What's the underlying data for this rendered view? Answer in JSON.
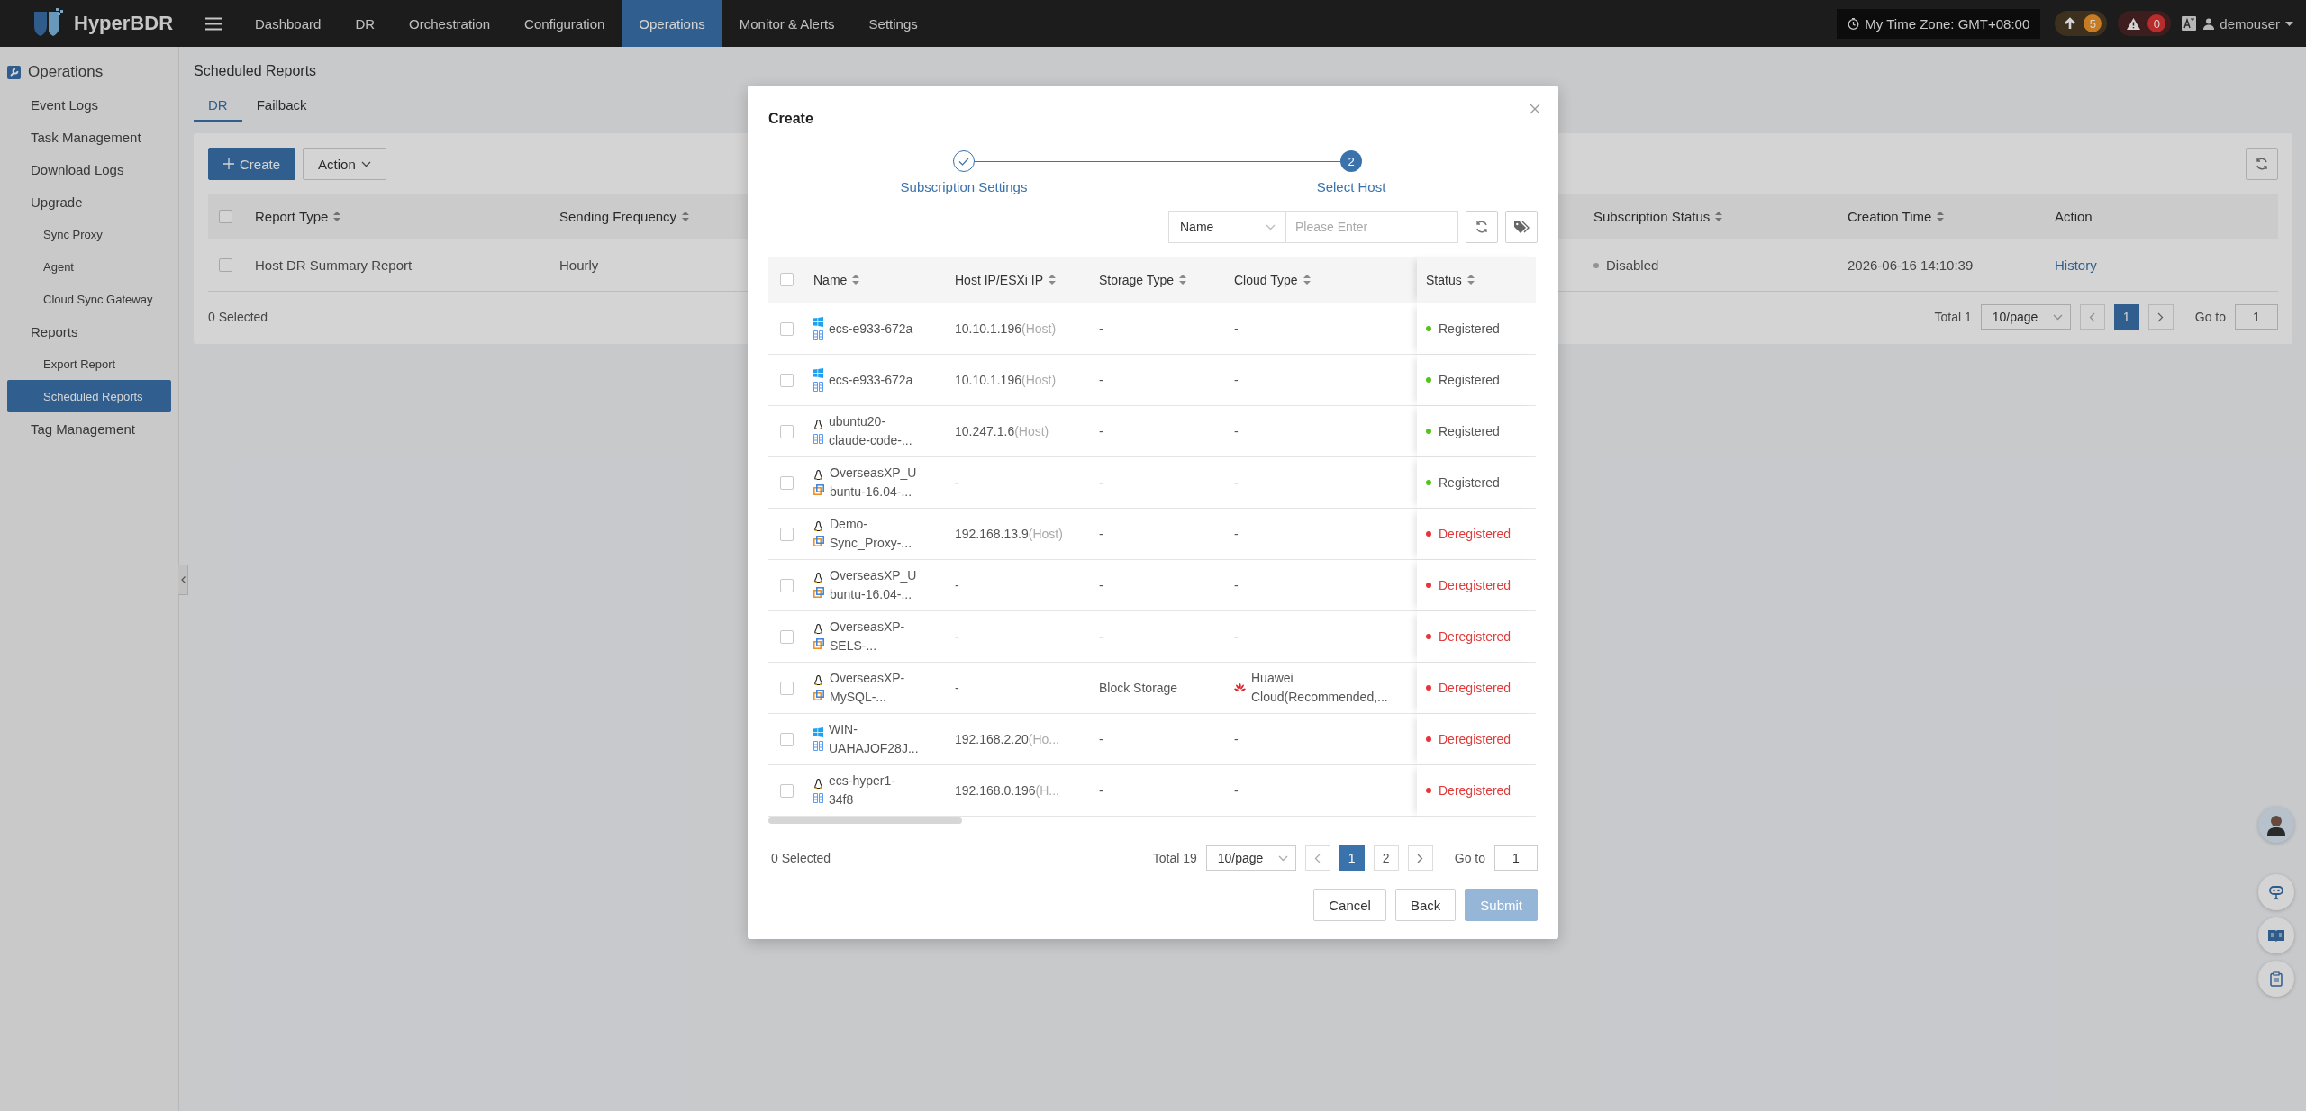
{
  "topbar": {
    "brand": "HyperBDR",
    "nav": [
      {
        "label": "Dashboard",
        "selected": false
      },
      {
        "label": "DR",
        "selected": false
      },
      {
        "label": "Orchestration",
        "selected": false
      },
      {
        "label": "Configuration",
        "selected": false
      },
      {
        "label": "Operations",
        "selected": true
      },
      {
        "label": "Monitor & Alerts",
        "selected": false
      },
      {
        "label": "Settings",
        "selected": false
      }
    ],
    "timezone": "My Time Zone: GMT+08:00",
    "upgrades": "5",
    "alerts": "0",
    "user": "demouser"
  },
  "sidebar": {
    "title": "Operations",
    "items": [
      {
        "label": "Event Logs",
        "selected": false
      },
      {
        "label": "Task Management",
        "selected": false
      },
      {
        "label": "Download Logs",
        "selected": false
      },
      {
        "label": "Upgrade",
        "selected": false,
        "children": [
          {
            "label": "Sync Proxy",
            "selected": false
          },
          {
            "label": "Agent",
            "selected": false
          },
          {
            "label": "Cloud Sync Gateway",
            "selected": false
          }
        ]
      },
      {
        "label": "Reports",
        "selected": false,
        "children": [
          {
            "label": "Export Report",
            "selected": false
          },
          {
            "label": "Scheduled Reports",
            "selected": true
          }
        ]
      },
      {
        "label": "Tag Management",
        "selected": false
      }
    ]
  },
  "page": {
    "title": "Scheduled Reports",
    "tabs": [
      {
        "label": "DR",
        "selected": true
      },
      {
        "label": "Failback",
        "selected": false
      }
    ],
    "create": "Create",
    "action": "Action",
    "table": {
      "all_checked": false,
      "columns": [
        {
          "label": "Report Type",
          "sortable": true
        },
        {
          "label": "Sending Frequency",
          "sortable": true
        },
        {
          "label": "Subscription Status",
          "sortable": true
        },
        {
          "label": "Creation Time",
          "sortable": true
        },
        {
          "label": "Action",
          "sortable": false
        }
      ],
      "rows": [
        {
          "checked": false,
          "report_type": "Host DR Summary Report",
          "frequency": "Hourly",
          "status": "Disabled",
          "color": "#b0b0b0",
          "error": false,
          "created": "2026-06-16 14:10:39",
          "action": "History"
        }
      ]
    },
    "footer": {
      "selected": "0 Selected",
      "total": "Total 1",
      "page_size": "10/page",
      "pages": [
        {
          "label": "1",
          "selected": true
        }
      ],
      "goto": "Go to",
      "goto_value": "1"
    }
  },
  "dialog": {
    "title": "Create",
    "steps": [
      {
        "label": "Subscription Settings",
        "done": true
      },
      {
        "label": "Select Host",
        "done": false,
        "number": "2"
      }
    ],
    "filter": {
      "field": "Name",
      "placeholder": "Please Enter"
    },
    "table": {
      "all_checked": false,
      "columns": [
        {
          "label": "Name",
          "sortable": true
        },
        {
          "label": "Host IP/ESXi IP",
          "sortable": true
        },
        {
          "label": "Storage Type",
          "sortable": true
        },
        {
          "label": "Cloud Type",
          "sortable": true
        },
        {
          "label": "Status",
          "sortable": true
        }
      ],
      "rows": [
        {
          "checked": false,
          "icons": [
            {
              "kind": "windows"
            },
            {
              "kind": "grid"
            }
          ],
          "name": "ecs-e933-672a",
          "ip": "10.10.1.196",
          "ip_note": "(Host)",
          "storage": "-",
          "cloud": "-",
          "status": "Registered",
          "color": "#52c41a",
          "error": false
        },
        {
          "checked": false,
          "icons": [
            {
              "kind": "windows"
            },
            {
              "kind": "grid"
            }
          ],
          "name": "ecs-e933-672a",
          "ip": "10.10.1.196",
          "ip_note": "(Host)",
          "storage": "-",
          "cloud": "-",
          "status": "Registered",
          "color": "#52c41a",
          "error": false
        },
        {
          "checked": false,
          "icons": [
            {
              "kind": "linux"
            },
            {
              "kind": "grid"
            }
          ],
          "name": "ubuntu20-claude-code-...",
          "ip": "10.247.1.6",
          "ip_note": "(Host)",
          "storage": "-",
          "cloud": "-",
          "status": "Registered",
          "color": "#52c41a",
          "error": false
        },
        {
          "checked": false,
          "icons": [
            {
              "kind": "linux"
            },
            {
              "kind": "stack"
            }
          ],
          "name": "OverseasXP_Ubuntu-16.04-...",
          "ip": "-",
          "storage": "-",
          "cloud": "-",
          "status": "Registered",
          "color": "#52c41a",
          "error": false
        },
        {
          "checked": false,
          "icons": [
            {
              "kind": "linux"
            },
            {
              "kind": "stack"
            }
          ],
          "name": "Demo-Sync_Proxy-...",
          "ip": "192.168.13.9",
          "ip_note": "(Host)",
          "storage": "-",
          "cloud": "-",
          "status": "Deregistered",
          "color": "#e8333a",
          "error": true
        },
        {
          "checked": false,
          "icons": [
            {
              "kind": "linux"
            },
            {
              "kind": "stack"
            }
          ],
          "name": "OverseasXP_Ubuntu-16.04-...",
          "ip": "-",
          "storage": "-",
          "cloud": "-",
          "status": "Deregistered",
          "color": "#e8333a",
          "error": true
        },
        {
          "checked": false,
          "icons": [
            {
              "kind": "linux"
            },
            {
              "kind": "stack"
            }
          ],
          "name": "OverseasXP-SELS-...",
          "ip": "-",
          "storage": "-",
          "cloud": "-",
          "status": "Deregistered",
          "color": "#e8333a",
          "error": true
        },
        {
          "checked": false,
          "icons": [
            {
              "kind": "linux"
            },
            {
              "kind": "stack"
            }
          ],
          "name": "OverseasXP-MySQL-...",
          "ip": "-",
          "storage": "Block Storage",
          "cloud": "Huawei Cloud(Recommended,...",
          "cloud_icons": [
            {
              "kind": "flower"
            }
          ],
          "status": "Deregistered",
          "color": "#e8333a",
          "error": true
        },
        {
          "checked": false,
          "icons": [
            {
              "kind": "windows"
            },
            {
              "kind": "grid"
            }
          ],
          "name": "WIN-UAHAJOF28J...",
          "ip": "192.168.2.20",
          "ip_note": "(Ho...",
          "storage": "-",
          "cloud": "-",
          "status": "Deregistered",
          "color": "#e8333a",
          "error": true
        },
        {
          "checked": false,
          "icons": [
            {
              "kind": "linux"
            },
            {
              "kind": "grid"
            }
          ],
          "name": "ecs-hyper1-34f8",
          "ip": "192.168.0.196",
          "ip_note": "(H...",
          "storage": "-",
          "cloud": "-",
          "status": "Deregistered",
          "color": "#e8333a",
          "error": true
        }
      ]
    },
    "footer": {
      "selected": "0 Selected",
      "total": "Total 19",
      "page_size": "10/page",
      "pages": [
        {
          "label": "1",
          "selected": true
        },
        {
          "label": "2",
          "selected": false
        }
      ],
      "goto": "Go to",
      "goto_value": "1"
    },
    "buttons": [
      {
        "label": "Cancel",
        "kind": "default",
        "disabled": false
      },
      {
        "label": "Back",
        "kind": "default",
        "disabled": false
      },
      {
        "label": "Submit",
        "kind": "primary",
        "disabled": true
      }
    ]
  }
}
